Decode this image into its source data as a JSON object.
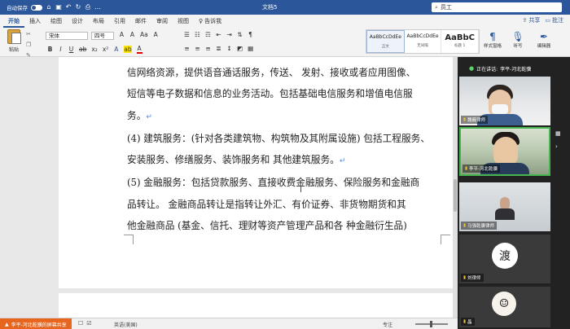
{
  "titlebar": {
    "autosave_label": "自动保存",
    "toggle_state": "关",
    "doc_title": "文档5",
    "search_value": "员工"
  },
  "menubar": {
    "tabs": [
      "开始",
      "插入",
      "绘图",
      "设计",
      "布局",
      "引用",
      "邮件",
      "审阅",
      "视图"
    ],
    "active_tab": "开始",
    "tell_me": "告诉我",
    "share": "共享",
    "comments": "批注"
  },
  "ribbon": {
    "paste_label": "粘贴",
    "font_name": "宋体",
    "font_size": "四号",
    "styles": [
      {
        "sample": "AaBbCcDdEe",
        "name": "正文"
      },
      {
        "sample": "AaBbCcDdEe",
        "name": "无间隔"
      },
      {
        "sample": "AaBbC",
        "name": "标题 1"
      }
    ],
    "styles_pane_label": "样式窗格",
    "dictate_label": "听写",
    "editor_label": "编辑器"
  },
  "document": {
    "lines": [
      "信网络资源，提供语音通话服务，传送、 发射、接收或者应用图像、",
      "短信等电子数据和信息的业务活动。包括基础电信服务和增值电信服",
      "务。",
      "(4) 建筑服务：(针对各类建筑物、构筑物及其附属设施) 包括工程服务、",
      "安装服务、修缮服务、装饰服务和 其他建筑服务。",
      "(5) 金融服务：包括贷款服务、直接收费金融服务、保险服务和金融商",
      "品转让。 金融商品转让是指转让外汇、有价证券、非货物期货和其",
      "他金融商品 (基金、信托、理财等资产管理产品和各 种金融衍生品)"
    ],
    "paragraph_mark": "↵"
  },
  "video": {
    "speaking_prefix": "正在讲话:",
    "speaking_name": "李平-河北乾骥",
    "participants": [
      {
        "name": "魏巍律师"
      },
      {
        "name": "李平-河北乾骥"
      },
      {
        "name": "马强乾骥律师"
      },
      {
        "name": "刘律师"
      },
      {
        "name": "晶"
      }
    ],
    "avatar4_text": "渡",
    "avatar5_text": "☺"
  },
  "statusbar": {
    "share_text": "李平-河北乾骥的屏幕共享",
    "language": "英语(美国)",
    "focus": "专注"
  }
}
